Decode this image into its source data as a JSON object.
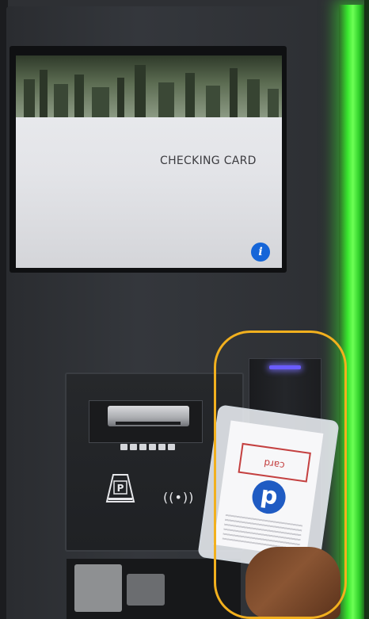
{
  "screen": {
    "message": "CHECKING CARD",
    "info_button": "i"
  },
  "panel": {
    "ticket_slot": "ticket-slot",
    "contactless_symbol": "((•))",
    "parking_icon": "parking-icon"
  },
  "card": {
    "logo_letter": "p",
    "stamp_text": "card"
  },
  "colors": {
    "highlight": "#f2b01e",
    "accent_green": "#39e72f",
    "info_blue": "#1565d8",
    "reader_light": "#6a5cff"
  }
}
